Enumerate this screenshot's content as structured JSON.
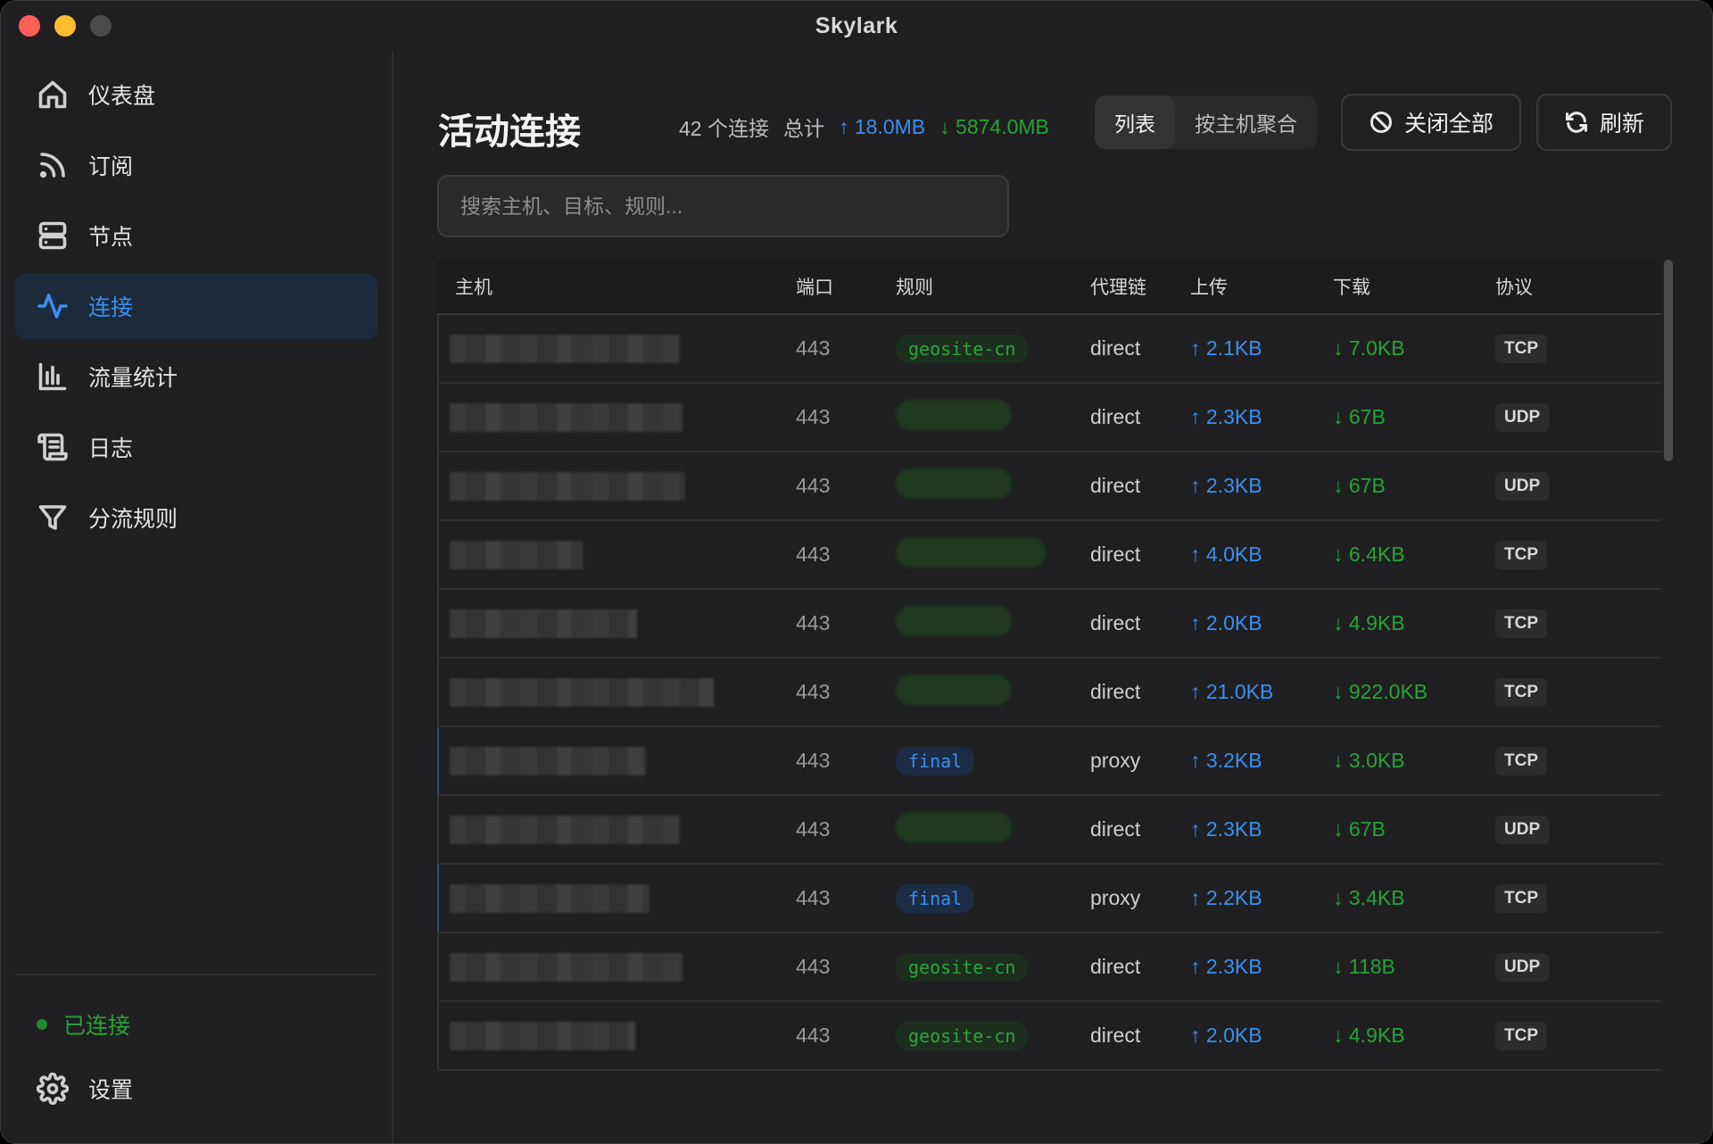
{
  "window": {
    "title": "Skylark"
  },
  "sidebar": {
    "items": [
      {
        "label": "仪表盘",
        "icon": "home-icon"
      },
      {
        "label": "订阅",
        "icon": "rss-icon"
      },
      {
        "label": "节点",
        "icon": "server-icon"
      },
      {
        "label": "连接",
        "icon": "activity-icon",
        "active": true
      },
      {
        "label": "流量统计",
        "icon": "bar-chart-icon"
      },
      {
        "label": "日志",
        "icon": "scroll-icon"
      },
      {
        "label": "分流规则",
        "icon": "filter-icon"
      }
    ],
    "status": "已连接",
    "settings": "设置"
  },
  "header": {
    "title": "活动连接",
    "count": "42 个连接",
    "total_label": "总计",
    "total_up": "↑ 18.0MB",
    "total_down": "↓ 5874.0MB",
    "view_list": "列表",
    "view_group": "按主机聚合",
    "close_all": "关闭全部",
    "refresh": "刷新"
  },
  "search": {
    "placeholder": "搜索主机、目标、规则..."
  },
  "table": {
    "columns": {
      "host": "主机",
      "port": "端口",
      "rule": "规则",
      "chain": "代理链",
      "up": "上传",
      "down": "下载",
      "proto": "协议"
    },
    "rows": [
      {
        "port": "443",
        "rule": "geosite-cn",
        "chain": "direct",
        "up": "↑ 2.1KB",
        "down": "↓ 7.0KB",
        "proto": "TCP"
      },
      {
        "port": "443",
        "rule": "",
        "chain": "direct",
        "up": "↑ 2.3KB",
        "down": "↓ 67B",
        "proto": "UDP"
      },
      {
        "port": "443",
        "rule": "",
        "chain": "direct",
        "up": "↑ 2.3KB",
        "down": "↓ 67B",
        "proto": "UDP"
      },
      {
        "port": "443",
        "rule": "",
        "chain": "direct",
        "up": "↑ 4.0KB",
        "down": "↓ 6.4KB",
        "proto": "TCP"
      },
      {
        "port": "443",
        "rule": "",
        "chain": "direct",
        "up": "↑ 2.0KB",
        "down": "↓ 4.9KB",
        "proto": "TCP"
      },
      {
        "port": "443",
        "rule": "",
        "chain": "direct",
        "up": "↑ 21.0KB",
        "down": "↓ 922.0KB",
        "proto": "TCP"
      },
      {
        "port": "443",
        "rule": "final",
        "chain": "proxy",
        "up": "↑ 3.2KB",
        "down": "↓ 3.0KB",
        "proto": "TCP"
      },
      {
        "port": "443",
        "rule": "",
        "chain": "direct",
        "up": "↑ 2.3KB",
        "down": "↓ 67B",
        "proto": "UDP"
      },
      {
        "port": "443",
        "rule": "final",
        "chain": "proxy",
        "up": "↑ 2.2KB",
        "down": "↓ 3.4KB",
        "proto": "TCP"
      },
      {
        "port": "443",
        "rule": "geosite-cn",
        "chain": "direct",
        "up": "↑ 2.3KB",
        "down": "↓ 118B",
        "proto": "UDP"
      },
      {
        "port": "443",
        "rule": "geosite-cn",
        "chain": "direct",
        "up": "↑ 2.0KB",
        "down": "↓ 4.9KB",
        "proto": "TCP"
      }
    ]
  }
}
